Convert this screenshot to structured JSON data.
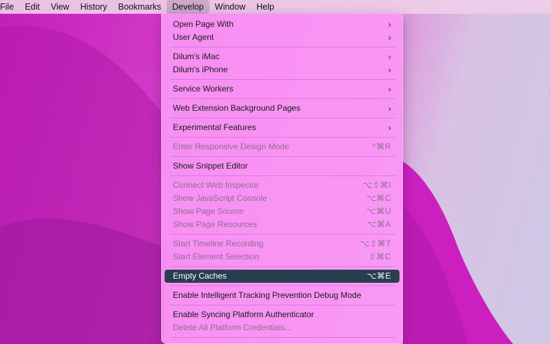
{
  "menubar": {
    "items": [
      "File",
      "Edit",
      "View",
      "History",
      "Bookmarks",
      "Develop",
      "Window",
      "Help"
    ],
    "active": "Develop"
  },
  "menu": {
    "items": [
      {
        "label": "Open Page With",
        "submenu": true,
        "shortcut": "",
        "disabled": false
      },
      {
        "label": "User Agent",
        "submenu": true,
        "shortcut": "",
        "disabled": false
      },
      {
        "label": "Dilum's iMac",
        "submenu": true,
        "shortcut": "",
        "disabled": false
      },
      {
        "label": "Dilum's iPhone",
        "submenu": true,
        "shortcut": "",
        "disabled": false
      },
      {
        "label": "Service Workers",
        "submenu": true,
        "shortcut": "",
        "disabled": false
      },
      {
        "label": "Web Extension Background Pages",
        "submenu": true,
        "shortcut": "",
        "disabled": false
      },
      {
        "label": "Experimental Features",
        "submenu": true,
        "shortcut": "",
        "disabled": false
      },
      {
        "label": "Enter Responsive Design Mode",
        "submenu": false,
        "shortcut": "^⌘R",
        "disabled": true
      },
      {
        "label": "Show Snippet Editor",
        "submenu": false,
        "shortcut": "",
        "disabled": false
      },
      {
        "label": "Connect Web Inspector",
        "submenu": false,
        "shortcut": "⌥⇧⌘I",
        "disabled": true
      },
      {
        "label": "Show JavaScript Console",
        "submenu": false,
        "shortcut": "⌥⌘C",
        "disabled": true
      },
      {
        "label": "Show Page Source",
        "submenu": false,
        "shortcut": "⌥⌘U",
        "disabled": true
      },
      {
        "label": "Show Page Resources",
        "submenu": false,
        "shortcut": "⌥⌘A",
        "disabled": true
      },
      {
        "label": "Start Timeline Recording",
        "submenu": false,
        "shortcut": "⌥⇧⌘T",
        "disabled": true
      },
      {
        "label": "Start Element Selection",
        "submenu": false,
        "shortcut": "⇧⌘C",
        "disabled": true
      },
      {
        "label": "Empty Caches",
        "submenu": false,
        "shortcut": "⌥⌘E",
        "disabled": false,
        "highlighted": true
      },
      {
        "label": "Enable Intelligent Tracking Prevention Debug Mode",
        "submenu": false,
        "shortcut": "",
        "disabled": false
      },
      {
        "label": "Enable Syncing Platform Authenticator",
        "submenu": false,
        "shortcut": "",
        "disabled": false
      },
      {
        "label": "Delete All Platform Credentials...",
        "submenu": false,
        "shortcut": "",
        "disabled": true
      }
    ],
    "chevron_glyph": "›"
  },
  "colors": {
    "highlight": "#283f52",
    "menu_bg": "#fb96f6",
    "wallpaper_magenta": "#c21fb8",
    "wallpaper_lavender": "#cfc9e6"
  }
}
